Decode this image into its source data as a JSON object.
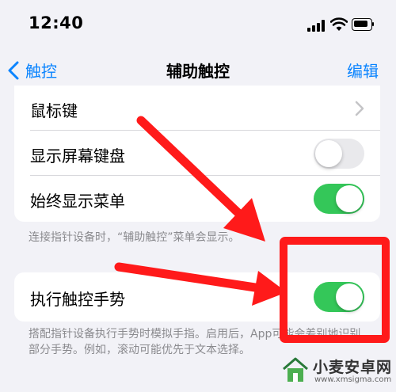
{
  "status": {
    "time": "12:40"
  },
  "nav": {
    "back_label": "触控",
    "title": "辅助触控",
    "edit_label": "编辑"
  },
  "group1": {
    "rows": [
      {
        "label": "鼠标键",
        "control": "chevron"
      },
      {
        "label": "显示屏幕键盘",
        "control": "switch",
        "on": false
      },
      {
        "label": "始终显示菜单",
        "control": "switch",
        "on": true
      }
    ],
    "footnote": "连接指针设备时，“辅助触控”菜单会显示。"
  },
  "group2": {
    "rows": [
      {
        "label": "执行触控手势",
        "control": "switch",
        "on": true
      }
    ],
    "footnote": "搭配指针设备执行手势时模拟手指。启用后，App可能会差别地识别部分手势。例如，滚动可能优先于文本选择。"
  },
  "colors": {
    "accent": "#0a84ff",
    "switch_on": "#34c759",
    "annotation": "#ff1a1a"
  },
  "watermark": {
    "text": "小麦安卓网",
    "url": "www.xmsigma.com"
  }
}
